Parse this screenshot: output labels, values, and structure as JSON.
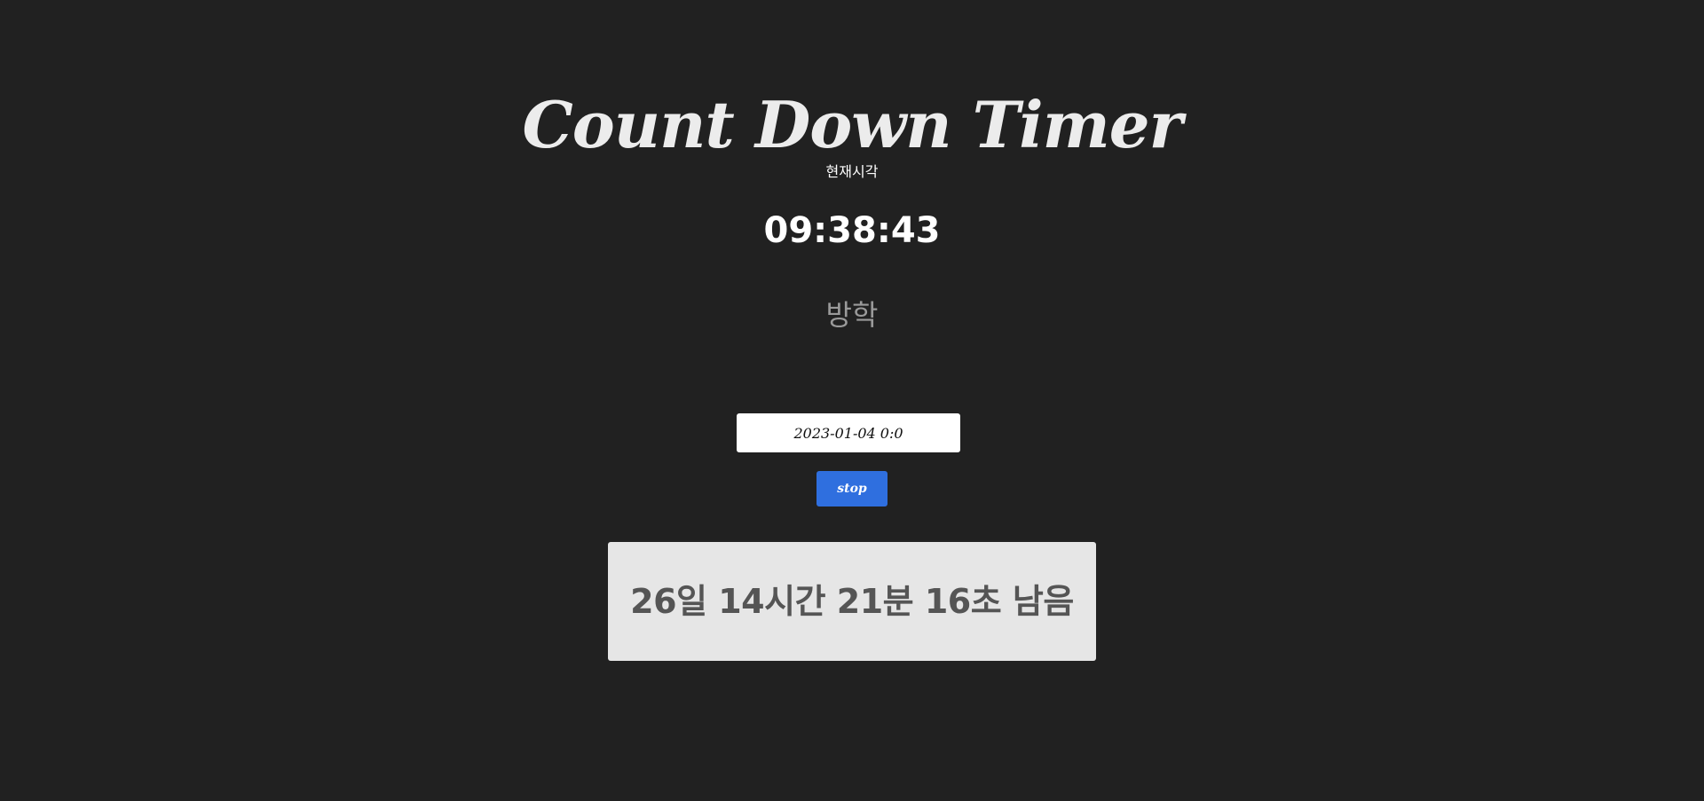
{
  "app": {
    "title": "Count Down Timer"
  },
  "current_time": {
    "label": "현재시각",
    "value": "09:38:43"
  },
  "event": {
    "label": "방학"
  },
  "target_input": {
    "value": "2023-01-04 0:0"
  },
  "controls": {
    "stop_label": "stop"
  },
  "countdown": {
    "remaining_text": "26일 14시간 21분 16초 남음"
  },
  "colors": {
    "background": "#212121",
    "button": "#2f6fdf",
    "result_box": "#e6e6e6",
    "result_text": "#555555",
    "event_label": "#9a9a9a"
  }
}
